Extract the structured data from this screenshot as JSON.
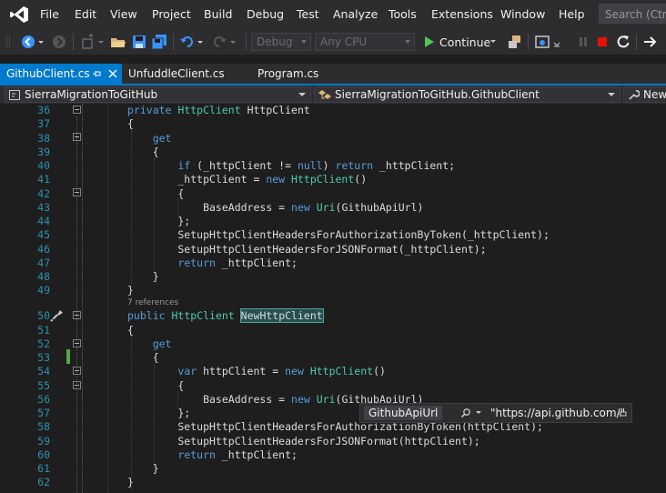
{
  "menubar": {
    "items": [
      "File",
      "Edit",
      "View",
      "Project",
      "Build",
      "Debug",
      "Test",
      "Analyze",
      "Tools",
      "Extensions",
      "Window",
      "Help"
    ],
    "search_placeholder": "Search (Ctrl+"
  },
  "toolbar": {
    "config_combo": "Debug",
    "platform_combo": "Any CPU",
    "continue_label": "Continue"
  },
  "tabs": [
    {
      "label": "GithubClient.cs",
      "active": true
    },
    {
      "label": "UnfuddleClient.cs",
      "active": false
    },
    {
      "label": "Program.cs",
      "active": false
    }
  ],
  "navbar": {
    "project": "SierraMigrationToGitHub",
    "type": "SierraMigrationToGitHub.GithubClient",
    "member": "NewH"
  },
  "editor": {
    "lines": [
      {
        "n": "36"
      },
      {
        "n": "37"
      },
      {
        "n": "38"
      },
      {
        "n": "39"
      },
      {
        "n": "40"
      },
      {
        "n": "41"
      },
      {
        "n": "42"
      },
      {
        "n": "43"
      },
      {
        "n": "44"
      },
      {
        "n": "45"
      },
      {
        "n": "46"
      },
      {
        "n": "47"
      },
      {
        "n": "48"
      },
      {
        "n": "49"
      },
      {
        "n": "50"
      },
      {
        "n": "51"
      },
      {
        "n": "52"
      },
      {
        "n": "53"
      },
      {
        "n": "54"
      },
      {
        "n": "55"
      },
      {
        "n": "56"
      },
      {
        "n": "57"
      },
      {
        "n": "58"
      },
      {
        "n": "59"
      },
      {
        "n": "60"
      },
      {
        "n": "61"
      },
      {
        "n": "62"
      }
    ],
    "codelens": "7 references"
  },
  "datatip": {
    "name": "GithubApiUrl",
    "value": "\"https://api.github.com/\""
  },
  "colors": {
    "accent": "#007acc",
    "keyword": "#569cd6",
    "type": "#4ec9b0",
    "line_number": "#2b91af",
    "change_marker": "#57a64a"
  }
}
